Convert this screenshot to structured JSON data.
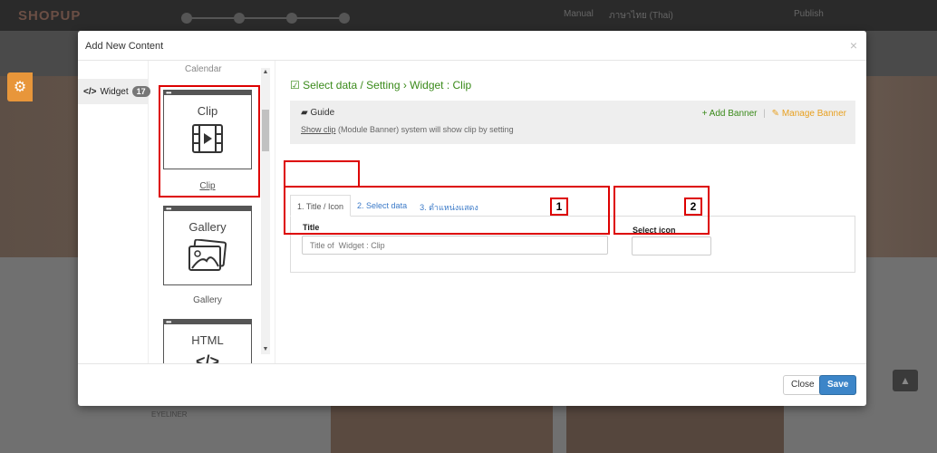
{
  "app": {
    "logo": "SHOPUP",
    "topbar_links": [
      "Manual",
      "ภาษาไทย (Thai)",
      "Publish"
    ],
    "bottom_caption": "EYELINER"
  },
  "modal": {
    "title": "Add New Content",
    "close_glyph": "×"
  },
  "left_nav": {
    "widget_label": "Widget",
    "widget_code": "</>",
    "widget_count": "17"
  },
  "widget_list": {
    "partial_label": "Calendar",
    "items": [
      {
        "title": "Clip",
        "label": "Clip",
        "icon": "video-clip-icon",
        "selected": true
      },
      {
        "title": "Gallery",
        "label": "Gallery",
        "icon": "image-gallery-icon",
        "selected": false
      },
      {
        "title": "HTML",
        "label": "",
        "icon": "code-icon",
        "selected": false
      }
    ]
  },
  "content": {
    "heading": "Select data / Setting › Widget : Clip",
    "guide": {
      "title": "Guide",
      "link_text": "Show clip",
      "desc": " (Module Banner) system will show clip by setting",
      "add_banner": "+ Add Banner",
      "manage_banner": "Manage Banner"
    },
    "tabs": [
      {
        "label": "1. Title / Icon",
        "active": true
      },
      {
        "label": "2. Select data",
        "active": false
      },
      {
        "label": "3. ตำแหน่งแสดง",
        "active": false
      }
    ],
    "form": {
      "title_label": "Title",
      "title_placeholder": "Title of  Widget : Clip",
      "icon_label": "Select icon"
    }
  },
  "annotations": [
    "1",
    "2"
  ],
  "footer": {
    "close": "Close",
    "save": "Save"
  },
  "colors": {
    "accent_green": "#3a8a1a",
    "link_blue": "#3b7ac8",
    "save_blue": "#3c85c8",
    "highlight_red": "#dd0000",
    "manage_orange": "#e8a020"
  }
}
